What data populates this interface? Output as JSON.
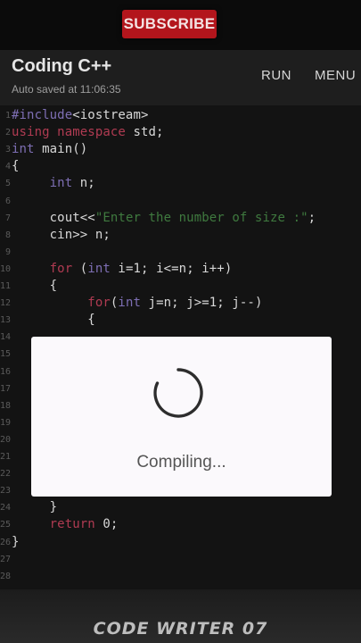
{
  "overlay": {
    "subscribe_label": "SUBSCRIBE",
    "watermark": "CODE WRITER 07"
  },
  "header": {
    "title": "Coding C++",
    "autosave": "Auto saved at 11:06:35",
    "run_label": "RUN",
    "menu_label": "MENU"
  },
  "editor": {
    "lines": [
      {
        "n": "1",
        "tokens": [
          {
            "t": "#include",
            "c": "ty"
          },
          {
            "t": "<iostream>",
            "c": ""
          }
        ]
      },
      {
        "n": "2",
        "tokens": [
          {
            "t": "using namespace",
            "c": "kw"
          },
          {
            "t": " std;",
            "c": ""
          }
        ]
      },
      {
        "n": "3",
        "tokens": [
          {
            "t": "int",
            "c": "ty"
          },
          {
            "t": " main()",
            "c": ""
          }
        ]
      },
      {
        "n": "4",
        "tokens": [
          {
            "t": "{",
            "c": ""
          }
        ]
      },
      {
        "n": "5",
        "tokens": [
          {
            "t": "     ",
            "c": ""
          },
          {
            "t": "int",
            "c": "ty"
          },
          {
            "t": " n;",
            "c": ""
          }
        ]
      },
      {
        "n": "6",
        "tokens": []
      },
      {
        "n": "7",
        "tokens": [
          {
            "t": "     cout<<",
            "c": ""
          },
          {
            "t": "\"Enter the number of size :\"",
            "c": "st"
          },
          {
            "t": ";",
            "c": ""
          }
        ]
      },
      {
        "n": "8",
        "tokens": [
          {
            "t": "     cin>> n;",
            "c": ""
          }
        ]
      },
      {
        "n": "9",
        "tokens": []
      },
      {
        "n": "10",
        "tokens": [
          {
            "t": "     ",
            "c": ""
          },
          {
            "t": "for",
            "c": "kw"
          },
          {
            "t": " (",
            "c": ""
          },
          {
            "t": "int",
            "c": "ty"
          },
          {
            "t": " i=1; i<=n; i++)",
            "c": ""
          }
        ]
      },
      {
        "n": "11",
        "tokens": [
          {
            "t": "     {",
            "c": ""
          }
        ]
      },
      {
        "n": "12",
        "tokens": [
          {
            "t": "          ",
            "c": ""
          },
          {
            "t": "for",
            "c": "kw"
          },
          {
            "t": "(",
            "c": ""
          },
          {
            "t": "int",
            "c": "ty"
          },
          {
            "t": " j=n; j>=1; j--)",
            "c": ""
          }
        ]
      },
      {
        "n": "13",
        "tokens": [
          {
            "t": "          {",
            "c": ""
          }
        ]
      },
      {
        "n": "14",
        "tokens": []
      },
      {
        "n": "15",
        "tokens": []
      },
      {
        "n": "16",
        "tokens": []
      },
      {
        "n": "17",
        "tokens": []
      },
      {
        "n": "18",
        "tokens": []
      },
      {
        "n": "19",
        "tokens": []
      },
      {
        "n": "20",
        "tokens": []
      },
      {
        "n": "21",
        "tokens": []
      },
      {
        "n": "22",
        "tokens": []
      },
      {
        "n": "23",
        "tokens": []
      },
      {
        "n": "24",
        "tokens": [
          {
            "t": "     }",
            "c": ""
          }
        ]
      },
      {
        "n": "25",
        "tokens": [
          {
            "t": "     ",
            "c": ""
          },
          {
            "t": "return",
            "c": "kw"
          },
          {
            "t": " 0;",
            "c": ""
          }
        ]
      },
      {
        "n": "26",
        "tokens": [
          {
            "t": "}",
            "c": ""
          }
        ]
      },
      {
        "n": "27",
        "tokens": []
      },
      {
        "n": "28",
        "tokens": []
      }
    ]
  },
  "dialog": {
    "message": "Compiling..."
  },
  "colors": {
    "keyword": "#b03b52",
    "type": "#7e6fb4",
    "string": "#3f7a3f",
    "subscribe_bg": "#b3151c"
  }
}
